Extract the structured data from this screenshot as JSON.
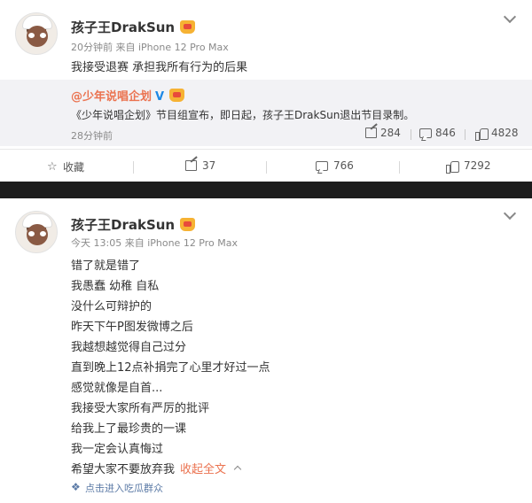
{
  "post1": {
    "username": "孩子王DrakSun",
    "meta": "20分钟前 来自 iPhone 12 Pro Max",
    "text": "我接受退赛 承担我所有行为的后果",
    "quote": {
      "username": "@少年说唱企划",
      "verified_badge": "V",
      "text": "《少年说唱企划》节目组宣布，即日起，孩子王DrakSun退出节目录制。",
      "time": "28分钟前",
      "shares": "284",
      "comments": "846",
      "likes": "4828"
    },
    "actions": {
      "favorite": "收藏",
      "shares": "37",
      "comments": "766",
      "likes": "7292"
    }
  },
  "post2": {
    "username": "孩子王DrakSun",
    "meta": "今天 13:05 来自 iPhone 12 Pro Max",
    "lines": [
      "错了就是错了",
      "我愚蠢 幼稚 自私",
      "没什么可辩护的",
      "昨天下午P图发微博之后",
      "我越想越觉得自己过分",
      "直到晚上12点补捐完了心里才好过一点",
      "感觉就像是自首...",
      "我接受大家所有严厉的批评",
      "给我上了最珍贵的一课",
      "我一定会认真悔过",
      "希望大家不要放弃我"
    ],
    "collapse_label": "收起全文",
    "supertopic": "点击进入吃瓜群众"
  },
  "icons": {
    "crown": "crown-icon",
    "chevron": "chevron-down-icon",
    "share": "share-icon",
    "comment": "comment-icon",
    "like": "thumbs-up-icon",
    "favorite": "star-icon"
  },
  "colors": {
    "link": "#eb7350",
    "verified": "#1e88e5",
    "meta": "#8a8a8a",
    "separator_bg": "#1c1c1c"
  }
}
